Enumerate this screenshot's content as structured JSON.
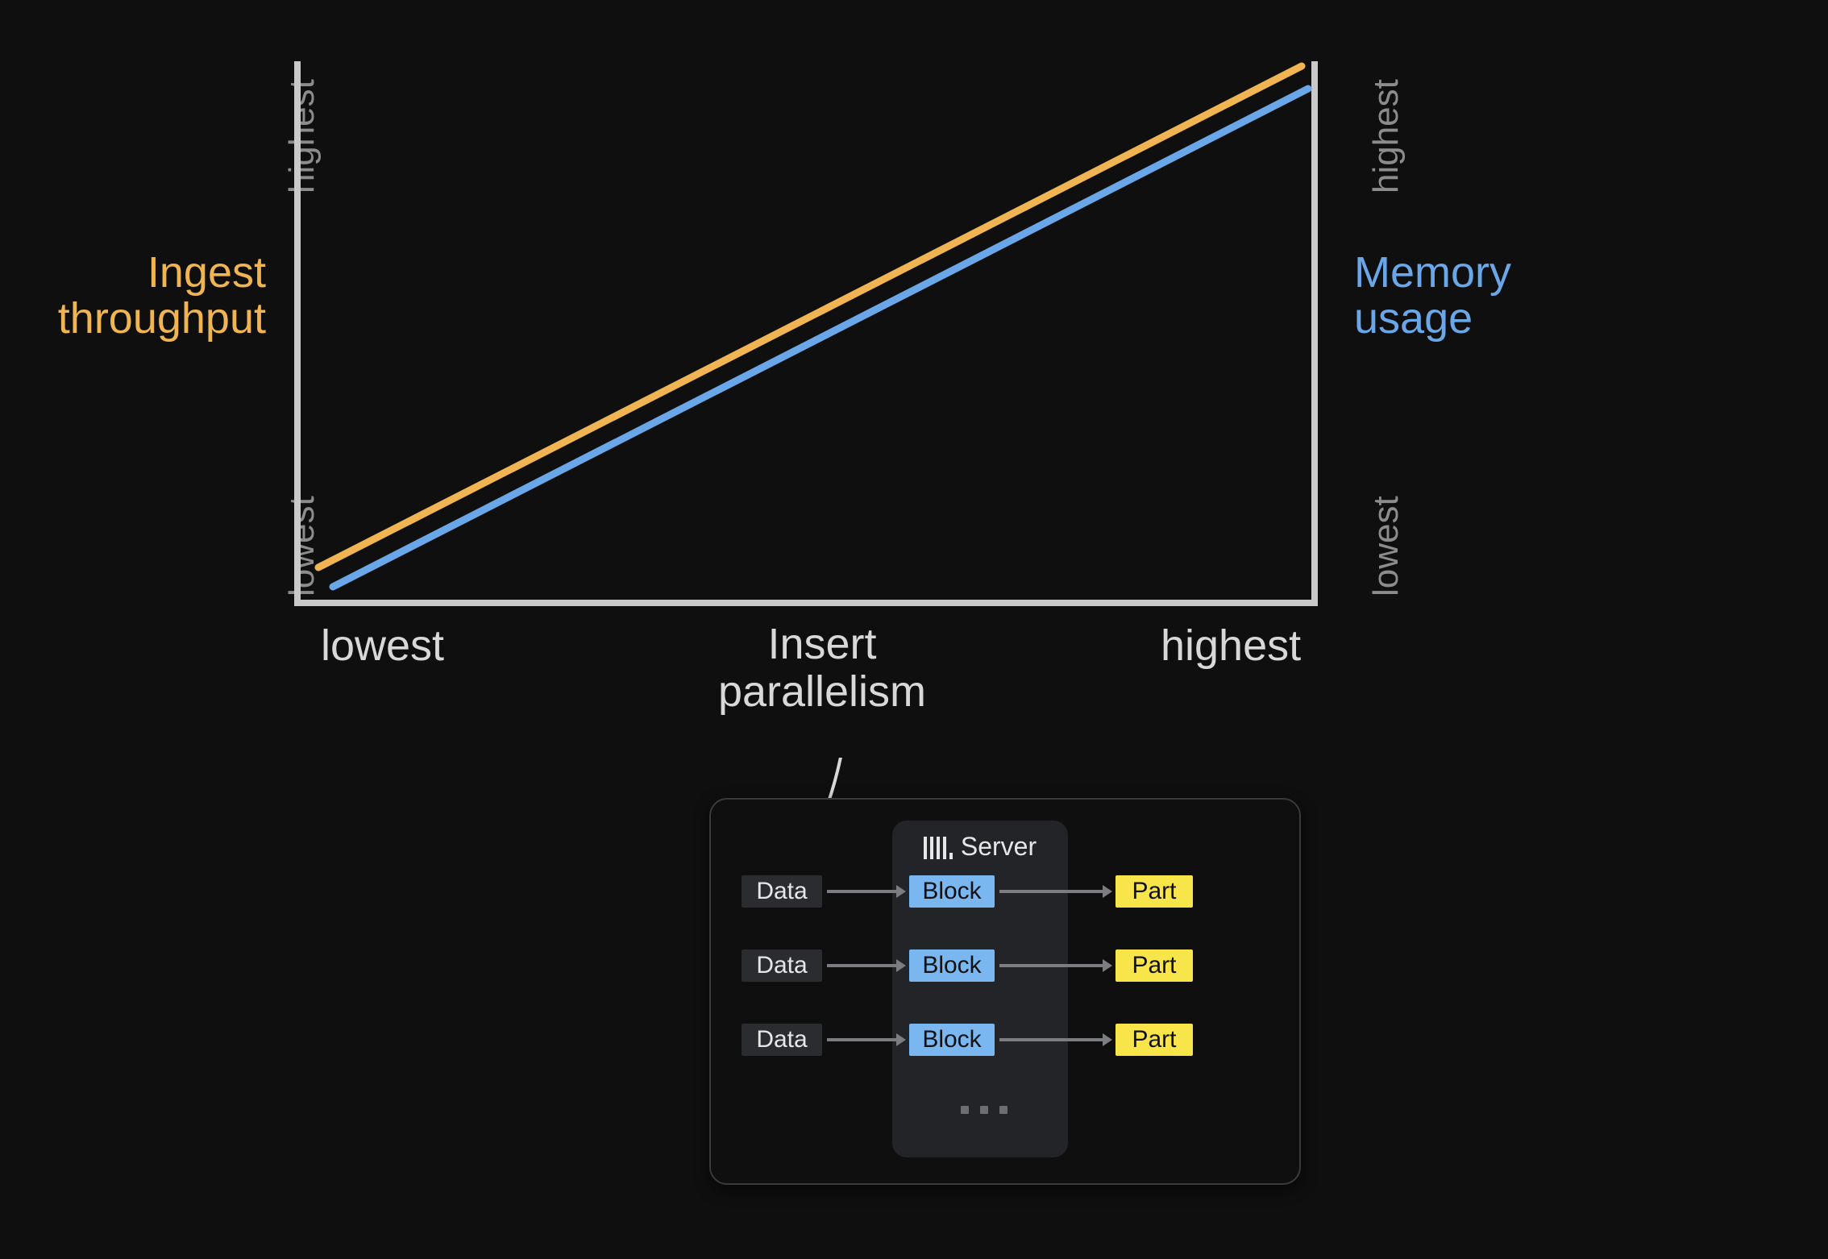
{
  "chart_data": {
    "type": "line",
    "x": [
      0,
      1
    ],
    "title": "",
    "xlabel": "Insert parallelism",
    "x_ticks": [
      "lowest",
      "highest"
    ],
    "y_left_label": "Ingest\nthroughput",
    "y_left_ticks": [
      "lowest",
      "highest"
    ],
    "y_right_label": "Memory\nusage",
    "y_right_ticks": [
      "lowest",
      "highest"
    ],
    "series": [
      {
        "name": "Ingest throughput",
        "color": "#f0b552",
        "values": [
          0.07,
          1.0
        ]
      },
      {
        "name": "Memory usage",
        "color": "#6aa7e8",
        "values": [
          0.03,
          0.96
        ]
      }
    ]
  },
  "y_left": {
    "line1": "Ingest",
    "line2": "throughput"
  },
  "y_right": {
    "line1": "Memory",
    "line2": "usage"
  },
  "x_axis": {
    "low": "lowest",
    "high": "highest",
    "label_line1": "Insert",
    "label_line2": "parallelism"
  },
  "y_ticks": {
    "low": "lowest",
    "high": "highest"
  },
  "panel": {
    "server_label": "Server",
    "rows": [
      {
        "data": "Data",
        "block": "Block",
        "part": "Part"
      },
      {
        "data": "Data",
        "block": "Block",
        "part": "Part"
      },
      {
        "data": "Data",
        "block": "Block",
        "part": "Part"
      }
    ]
  }
}
